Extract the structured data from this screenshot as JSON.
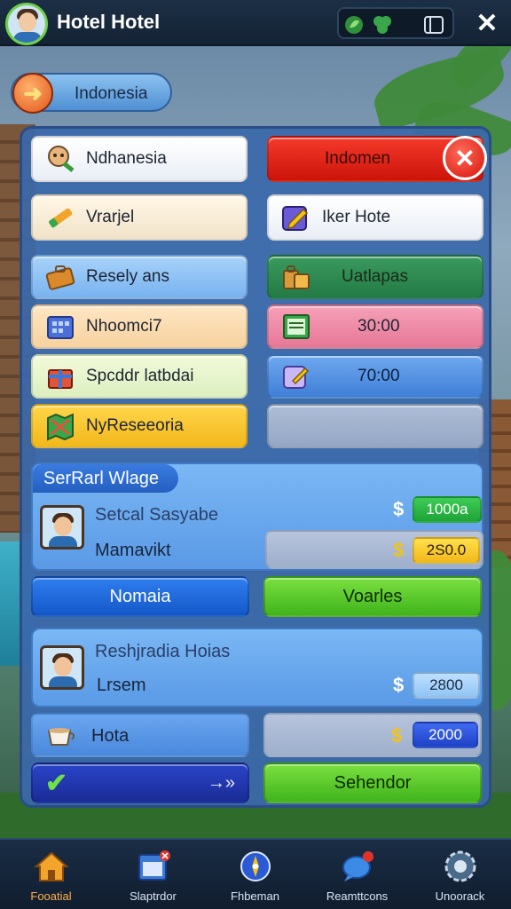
{
  "app": {
    "title": "Hotel Hotel"
  },
  "location": {
    "label": "Indonesia"
  },
  "grid": {
    "left": [
      {
        "label": "Ndhanesia",
        "icon": "tourist-icon"
      },
      {
        "label": "Vrarjel",
        "icon": "pencil-icon"
      },
      {
        "label": "Resely ans",
        "icon": "briefcase-icon"
      },
      {
        "label": "Nhoomci7",
        "icon": "building-icon"
      },
      {
        "label": "Spcddr latbdai",
        "icon": "gift-icon"
      },
      {
        "label": "NyReseeoria",
        "icon": "map-icon"
      }
    ],
    "right": [
      {
        "label": "Indomen",
        "icon": "close-icon"
      },
      {
        "label": "Iker Hote",
        "icon": "edit-icon"
      },
      {
        "label": "Uatlapas",
        "icon": "luggage-icon"
      },
      {
        "label": "30:00",
        "icon": "ledger-icon"
      },
      {
        "label": "70:00",
        "icon": "note-icon"
      },
      {
        "label": "",
        "icon": ""
      }
    ]
  },
  "section1": {
    "title": "SerRarl Wlage",
    "guest_name": "Setcal Sasyabe",
    "guest_detail": "Mamavikt",
    "value1": "1000a",
    "value2": "2S0.0",
    "currency1": "$",
    "currency2": "$"
  },
  "actions1": {
    "left": "Nomaia",
    "right": "Voarles"
  },
  "section2": {
    "guest_name": "Reshjradia Hoias",
    "guest_detail": "Lrsem",
    "value": "2800",
    "currency": "$"
  },
  "row_hota": {
    "label": "Hota",
    "value": "2000",
    "currency": "$"
  },
  "actions2": {
    "left_arrow": "→»",
    "right": "Sehendor"
  },
  "bottom_nav": [
    {
      "label": "Fooatial",
      "icon": "home-icon",
      "active": true
    },
    {
      "label": "Slaptrdor",
      "icon": "calendar-icon",
      "active": false
    },
    {
      "label": "Fhbeman",
      "icon": "compass-icon",
      "active": false
    },
    {
      "label": "Reamttcons",
      "icon": "chat-icon",
      "active": false
    },
    {
      "label": "Unoorack",
      "icon": "settings-icon",
      "active": false
    }
  ],
  "colors": {
    "accent_green": "#3fb41c",
    "accent_blue": "#1458c8",
    "alert_red": "#cc140b"
  }
}
